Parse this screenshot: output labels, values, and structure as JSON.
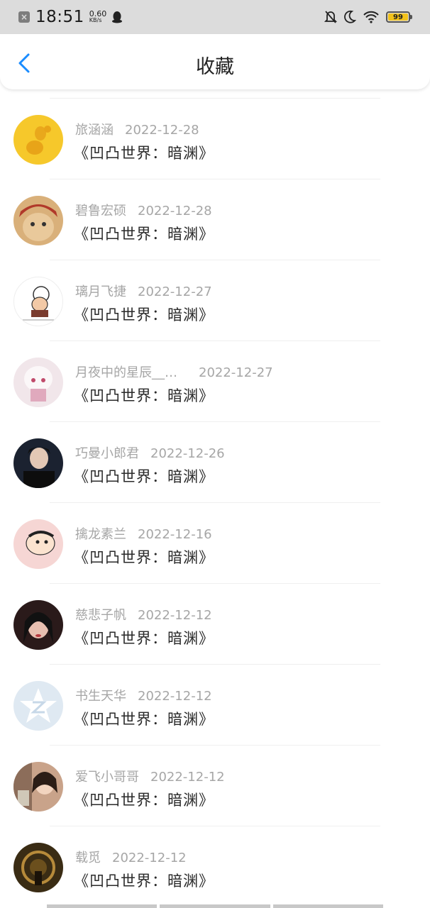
{
  "status": {
    "time": "18:51",
    "speed": "0.60",
    "speed_unit": "KB/s",
    "battery": "99"
  },
  "header": {
    "title": "收藏"
  },
  "items": [
    {
      "user": "旅涵涵",
      "date": "2022-12-28",
      "book": "《凹凸世界：暗渊》"
    },
    {
      "user": "碧鲁宏硕",
      "date": "2022-12-28",
      "book": "《凹凸世界：暗渊》"
    },
    {
      "user": "璃月飞捷",
      "date": "2022-12-27",
      "book": "《凹凸世界：暗渊》"
    },
    {
      "user": "月夜中的星辰__…",
      "date": "2022-12-27",
      "book": "《凹凸世界：暗渊》"
    },
    {
      "user": "巧曼小郎君",
      "date": "2022-12-26",
      "book": "《凹凸世界：暗渊》"
    },
    {
      "user": "擒龙素兰",
      "date": "2022-12-16",
      "book": "《凹凸世界：暗渊》"
    },
    {
      "user": "慈悲子帆",
      "date": "2022-12-12",
      "book": "《凹凸世界：暗渊》"
    },
    {
      "user": "书生天华",
      "date": "2022-12-12",
      "book": "《凹凸世界：暗渊》"
    },
    {
      "user": "爱飞小哥哥",
      "date": "2022-12-12",
      "book": "《凹凸世界：暗渊》"
    },
    {
      "user": "载觅",
      "date": "2022-12-12",
      "book": "《凹凸世界：暗渊》"
    }
  ],
  "colors": {
    "accent": "#1a8cff",
    "meta_text": "#a6a6a6",
    "status_bg": "#dcdcdc"
  }
}
